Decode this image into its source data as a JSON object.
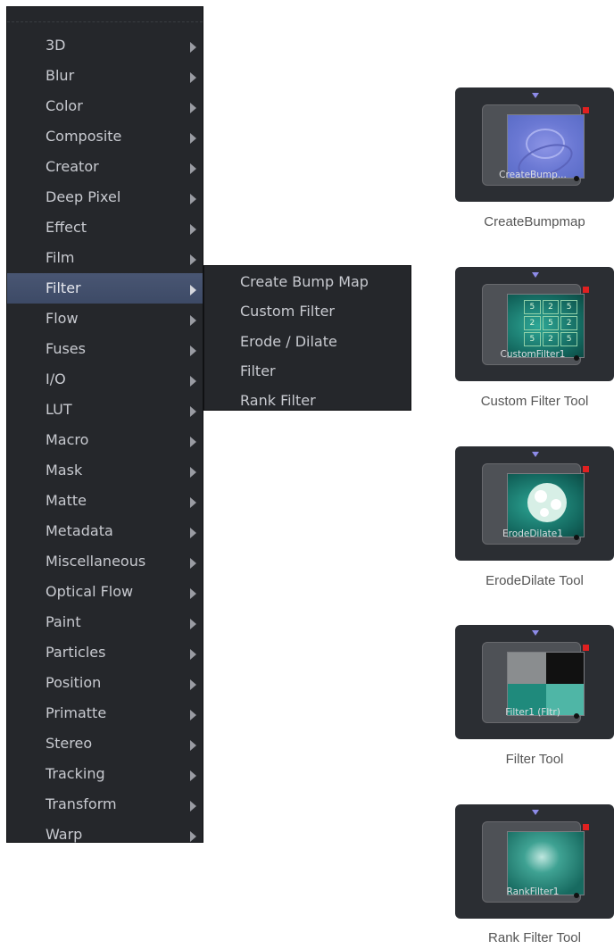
{
  "menu": {
    "items": [
      {
        "label": "3D",
        "active": false
      },
      {
        "label": "Blur",
        "active": false
      },
      {
        "label": "Color",
        "active": false
      },
      {
        "label": "Composite",
        "active": false
      },
      {
        "label": "Creator",
        "active": false
      },
      {
        "label": "Deep Pixel",
        "active": false
      },
      {
        "label": "Effect",
        "active": false
      },
      {
        "label": "Film",
        "active": false
      },
      {
        "label": "Filter",
        "active": true
      },
      {
        "label": "Flow",
        "active": false
      },
      {
        "label": "Fuses",
        "active": false
      },
      {
        "label": "I/O",
        "active": false
      },
      {
        "label": "LUT",
        "active": false
      },
      {
        "label": "Macro",
        "active": false
      },
      {
        "label": "Mask",
        "active": false
      },
      {
        "label": "Matte",
        "active": false
      },
      {
        "label": "Metadata",
        "active": false
      },
      {
        "label": "Miscellaneous",
        "active": false
      },
      {
        "label": "Optical Flow",
        "active": false
      },
      {
        "label": "Paint",
        "active": false
      },
      {
        "label": "Particles",
        "active": false
      },
      {
        "label": "Position",
        "active": false
      },
      {
        "label": "Primatte",
        "active": false
      },
      {
        "label": "Stereo",
        "active": false
      },
      {
        "label": "Tracking",
        "active": false
      },
      {
        "label": "Transform",
        "active": false
      },
      {
        "label": "Warp",
        "active": false
      }
    ]
  },
  "submenu": {
    "items": [
      "Create Bump Map",
      "Custom Filter",
      "Erode / Dilate",
      "Filter",
      "Rank Filter"
    ]
  },
  "nodes": [
    {
      "node_label": "CreateBump...",
      "caption": "CreateBumpmap"
    },
    {
      "node_label": "CustomFilter1",
      "caption": "Custom Filter Tool",
      "grid": [
        "5",
        "2",
        "5",
        "2",
        "5",
        "2",
        "5",
        "2",
        "5"
      ]
    },
    {
      "node_label": "ErodeDilate1",
      "caption": "ErodeDilate Tool"
    },
    {
      "node_label": "Filter1  (Fltr)",
      "caption": "Filter Tool"
    },
    {
      "node_label": "RankFilter1",
      "caption": "Rank Filter Tool"
    }
  ],
  "colors": {
    "menu_bg": "#25272b",
    "menu_highlight": "#435070",
    "input_triangle": "#e2b21a",
    "output_square": "#e02020",
    "top_triangle": "#8d8be8"
  }
}
